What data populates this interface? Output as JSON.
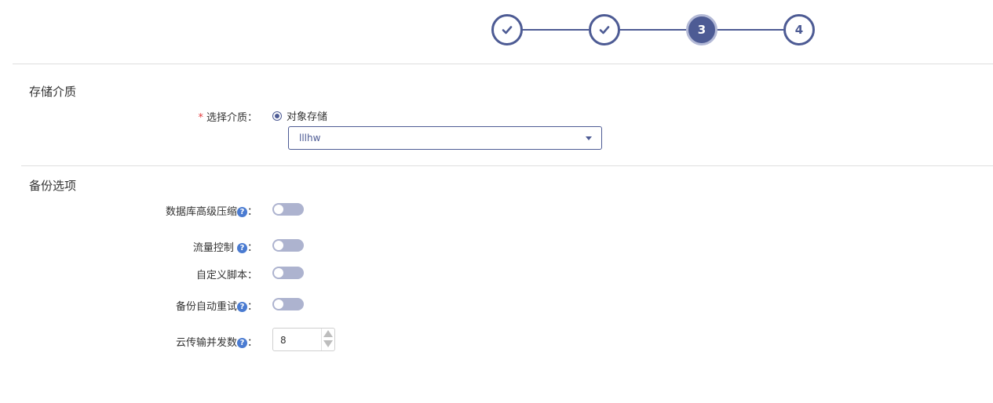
{
  "stepper": {
    "steps": [
      {
        "label": "✓",
        "state": "done"
      },
      {
        "label": "✓",
        "state": "done"
      },
      {
        "label": "3",
        "state": "active"
      },
      {
        "label": "4",
        "state": "pending"
      }
    ],
    "color": "#4d5b94"
  },
  "storage": {
    "section_title": "存储介质",
    "medium_label": "选择介质：",
    "required_mark": "*",
    "radio_option": "对象存储",
    "select_value": "lllhw"
  },
  "backup": {
    "section_title": "备份选项",
    "compression_label": "数据库高级压缩",
    "flow_control_label": "流量控制 ",
    "custom_script_label": "自定义脚本：",
    "auto_retry_label": "备份自动重试",
    "cloud_concurrency_label": "云传输并发数",
    "cloud_concurrency_value": "8",
    "colon": "：",
    "help_glyph": "?"
  },
  "colors": {
    "accent": "#4d5b94",
    "toggle_off": "#adb3cf",
    "help": "#4a7bd1",
    "required": "#e4393c"
  }
}
